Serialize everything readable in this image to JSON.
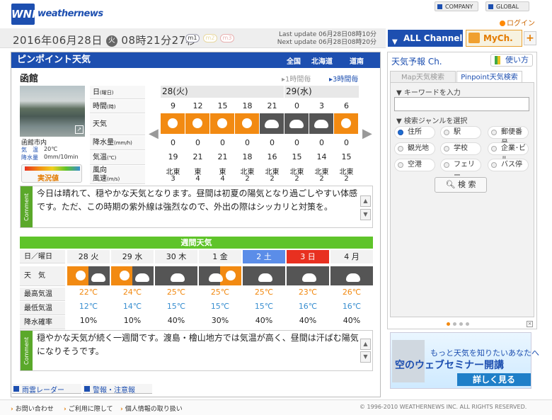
{
  "header": {
    "logo_mark": "WNI",
    "brand": "weathernews",
    "company": "COMPANY",
    "global": "GLOBAL",
    "login": "ログイン"
  },
  "datebar": {
    "date": "2016年06月28日",
    "weekday": "火",
    "time": "08時21分27秒",
    "badges": [
      "m1",
      "m2",
      "m3"
    ],
    "last_update": "Last update  06月28日08時10分",
    "next_update": "Next update  06月28日08時20分"
  },
  "channels": {
    "all": "ALL Channel",
    "my": "MyCh.",
    "plus": "+"
  },
  "main": {
    "title": "ピンポイント天気",
    "regions": [
      "全国",
      "北海道",
      "道南"
    ],
    "city": "函館",
    "hourly1": "1時間毎",
    "hourly3": "3時間毎",
    "photo_title": "函館市内",
    "photo_rows": [
      {
        "label": "気　温",
        "value": "20℃"
      },
      {
        "label": "降水量",
        "value": "0mm/10min"
      }
    ],
    "live": "実況値"
  },
  "grid": {
    "labels": {
      "day": "日",
      "day_s": "(曜日)",
      "time": "時間",
      "time_s": "(時)",
      "weather": "天気",
      "precip": "降水量",
      "precip_s": "(mm/h)",
      "temp": "気温",
      "temp_s": "(℃)",
      "wind1": "風向",
      "wind2": "風速",
      "wind_s": "(m/s)"
    },
    "days": [
      "28(火)",
      "29(水)"
    ],
    "hours": [
      "9",
      "12",
      "15",
      "18",
      "21",
      "0",
      "3",
      "6"
    ],
    "weather": [
      "sun",
      "sun",
      "sun",
      "sun",
      "cloud",
      "cloud",
      "cloud",
      "sun"
    ],
    "precip": [
      "0",
      "0",
      "0",
      "0",
      "0",
      "0",
      "0",
      "0"
    ],
    "temps": [
      "19",
      "21",
      "21",
      "18",
      "16",
      "15",
      "14",
      "15"
    ],
    "wind_dir": [
      "北東",
      "東",
      "東",
      "北東",
      "北東",
      "北東",
      "北東",
      "北東"
    ],
    "wind_spd": [
      "3",
      "4",
      "4",
      "2",
      "2",
      "2",
      "2",
      "2"
    ]
  },
  "comment1": {
    "tag": "Comment",
    "text": "今日は晴れて、穏やかな天気となります。昼間は初夏の陽気となり過ごしやすい体感です。ただ、この時期の紫外線は強烈なので、外出の際はシッカリと対策を。"
  },
  "weekly": {
    "title": "週間天気",
    "labels": [
      "日／曜日",
      "天　気",
      "最高気温",
      "最低気温",
      "降水確率"
    ],
    "days": [
      "28 火",
      "29 水",
      "30 木",
      "1 金",
      "2 土",
      "3 日",
      "4 月"
    ],
    "icons": [
      "sun-cloud",
      "sun-cloud",
      "cloud",
      "cloud-sun",
      "cloud",
      "cloud",
      "cloud"
    ],
    "max": [
      "22℃",
      "24℃",
      "25℃",
      "25℃",
      "25℃",
      "23℃",
      "26℃"
    ],
    "min": [
      "12℃",
      "14℃",
      "15℃",
      "15℃",
      "15℃",
      "16℃",
      "16℃"
    ],
    "pop": [
      "10%",
      "10%",
      "40%",
      "30%",
      "40%",
      "40%",
      "40%"
    ],
    "colors": {
      "sat": "#5b8de8",
      "sun": "#e83020"
    }
  },
  "comment2": {
    "tag": "Comment",
    "text": "穏やかな天気が続く一週間です。渡島・檜山地方では気温が高く、昼間は汗ばむ陽気になりそうです。"
  },
  "bottom_tabs": [
    "雨雲レーダー",
    "警報・注意報"
  ],
  "footer": {
    "links": [
      "お問い合わせ",
      "ご利用に際して",
      "個人情報の取り扱い"
    ],
    "copyright": "© 1996-2010 WEATHERNEWS INC. ALL RIGHTS RESERVED."
  },
  "side": {
    "title": "天気予報 Ch.",
    "usage": "使い方",
    "tabs": [
      "Map天気検索",
      "Pinpoint天気検索"
    ],
    "keyword_label": "▼ キーワードを入力",
    "genre_label": "▼ 検索ジャンルを選択",
    "radios": [
      [
        "住所",
        "駅",
        "郵便番号"
      ],
      [
        "観光地",
        "学校",
        "企業･ビル"
      ],
      [
        "空港",
        "フェリー",
        "バス停"
      ]
    ],
    "search": "検 索",
    "banner1": "もっと天気を知りたいあなたへ",
    "banner2": "空のウェブセミナー開講",
    "banner3": "詳しく見る"
  }
}
